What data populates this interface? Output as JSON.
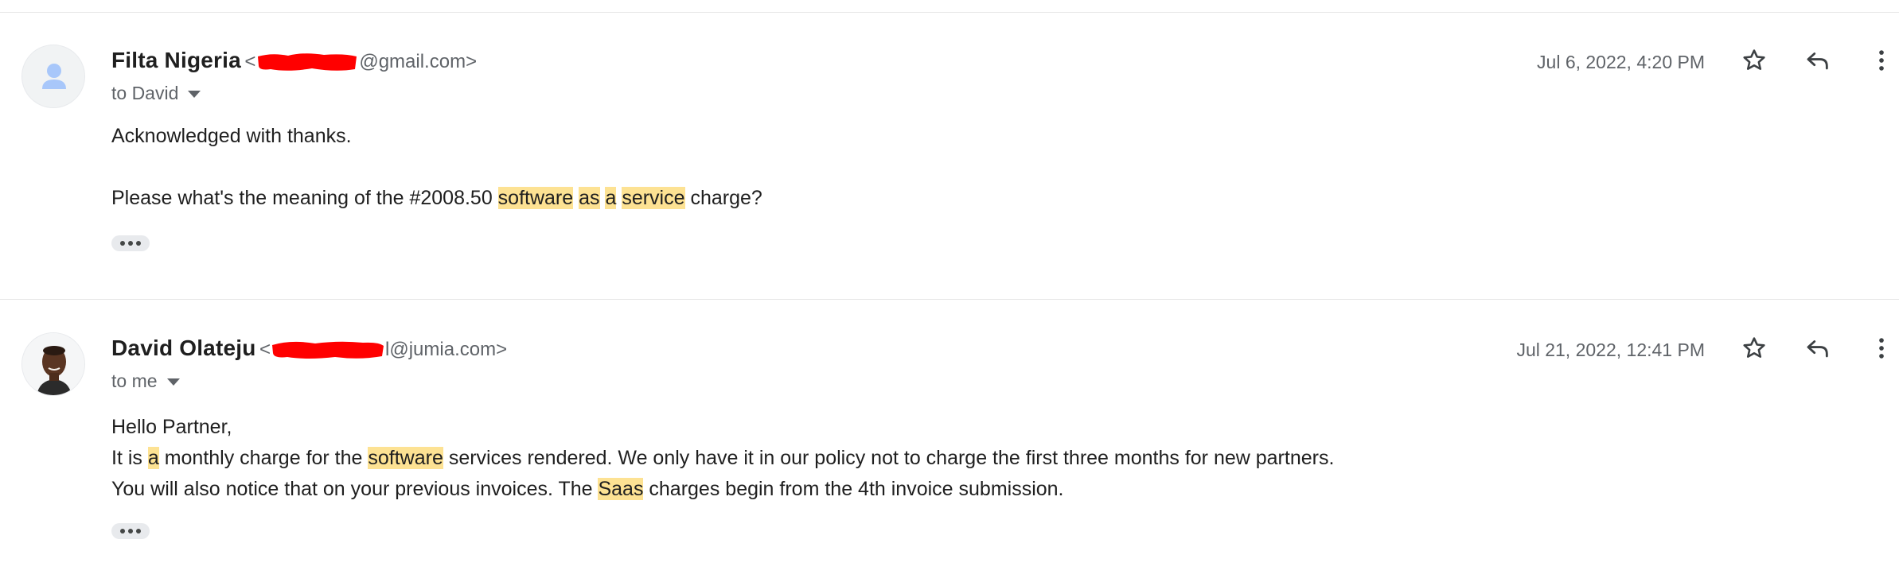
{
  "messages": [
    {
      "sender": "Filta Nigeria",
      "address_prefix": "<",
      "address_suffix": "@gmail.com>",
      "recipient": "to David",
      "date": "Jul 6, 2022, 4:20 PM",
      "body": {
        "line1": "Acknowledged with thanks.",
        "line2_a": "Please what's the meaning of the #2008.50 ",
        "line2_hl1": "software",
        "line2_hl2": "as",
        "line2_hl3": "a",
        "line2_hl4": "service",
        "line2_b": " charge?"
      }
    },
    {
      "sender": "David Olateju",
      "address_prefix": "<",
      "address_suffix": "l@jumia.com>",
      "recipient": "to me",
      "date": "Jul 21, 2022, 12:41 PM",
      "body": {
        "line1": "Hello Partner,",
        "line2_a": "It is ",
        "line2_hl1": "a",
        "line2_b": " monthly charge for the ",
        "line2_hl2": "software",
        "line2_c": " services rendered. We only have it in our policy not to charge the first three months for new partners.",
        "line3_a": "You will also notice that on your previous invoices. The ",
        "line3_hl": "Saas",
        "line3_b": " charges begin from the 4th invoice submission."
      }
    }
  ],
  "colors": {
    "highlight": "#fde293",
    "redaction": "#ff0000",
    "avatar_generic": "#a8c7fa"
  },
  "icons": [
    "person-icon",
    "star-icon",
    "reply-icon",
    "more-vert-icon",
    "chevron-down-icon",
    "ellipsis-icon"
  ]
}
